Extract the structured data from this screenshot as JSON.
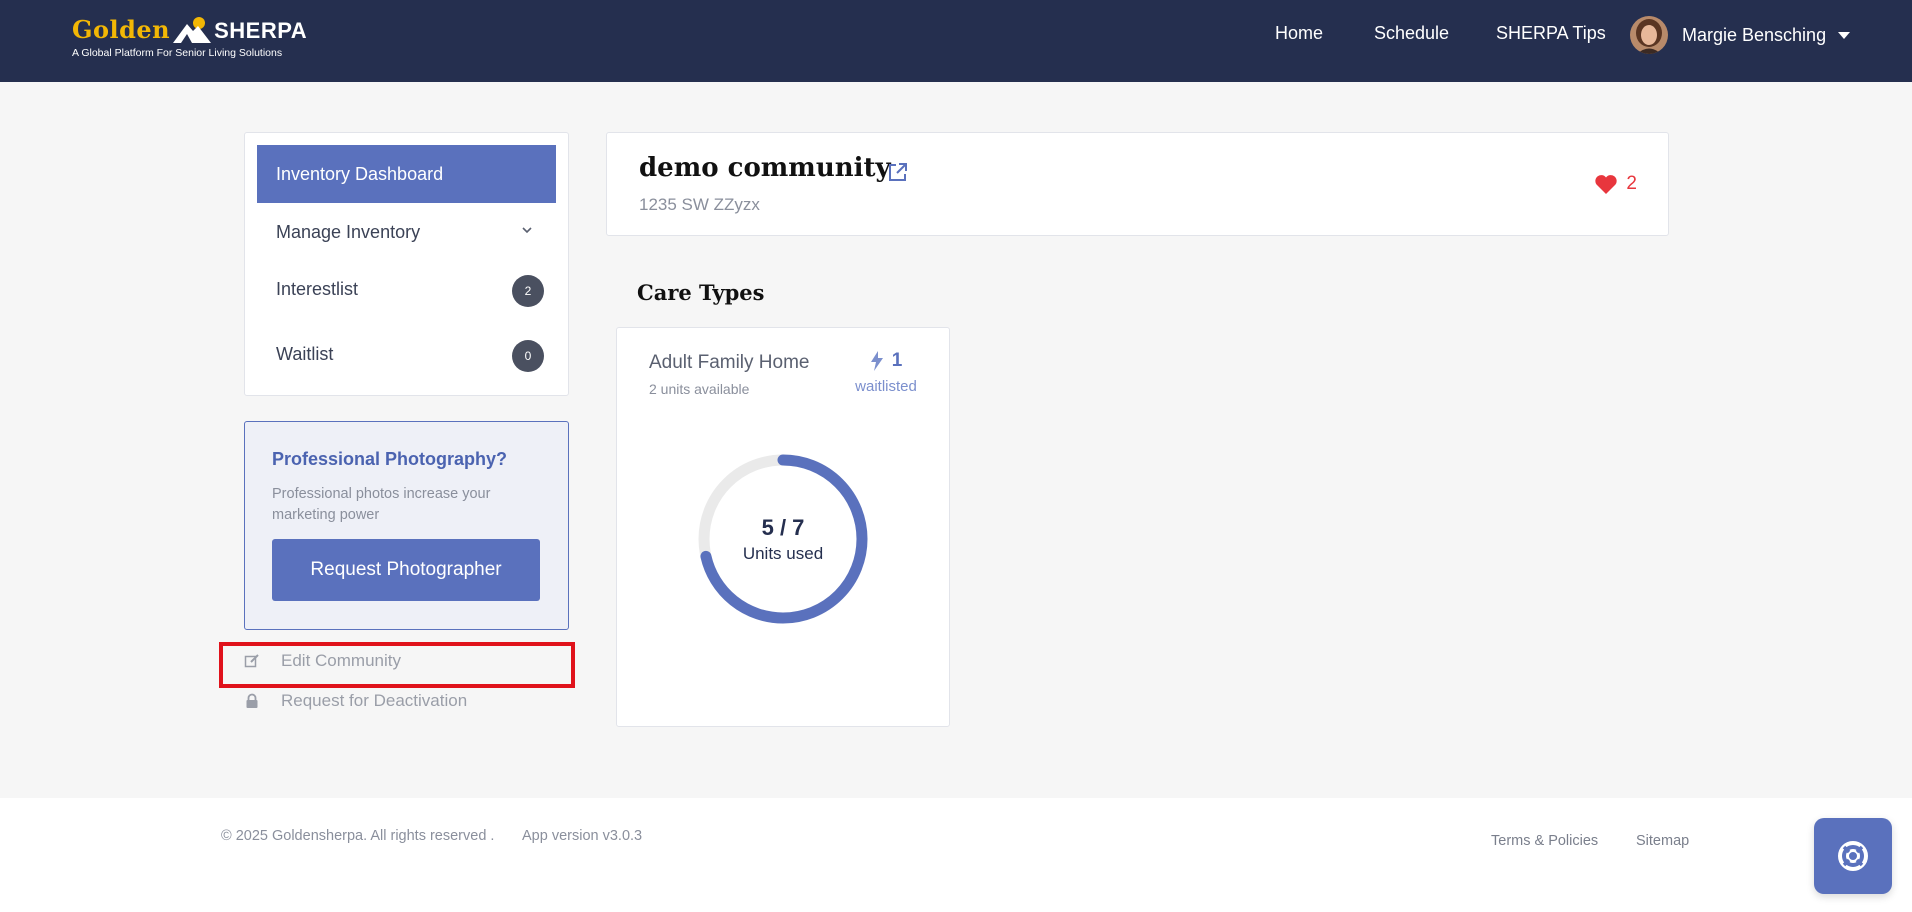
{
  "header": {
    "logo": {
      "golden": "Golden",
      "sherpa": "SHERPA",
      "tagline": "A Global Platform For Senior Living Solutions"
    },
    "nav": [
      {
        "label": "Home"
      },
      {
        "label": "Schedule"
      },
      {
        "label": "SHERPA Tips"
      }
    ],
    "user": {
      "name": "Margie Bensching",
      "avatar_icon": "user-avatar"
    }
  },
  "sidebar": {
    "items": [
      {
        "label": "Inventory Dashboard",
        "active": true
      },
      {
        "label": "Manage Inventory",
        "icon": "chevron-down-icon"
      },
      {
        "label": "Interestlist",
        "badge": "2"
      },
      {
        "label": "Waitlist",
        "badge": "0"
      }
    ],
    "promo": {
      "title": "Professional Photography?",
      "text": "Professional photos increase your marketing power",
      "button_label": "Request Photographer"
    },
    "links": [
      {
        "label": "Edit Community",
        "icon": "edit-icon"
      },
      {
        "label": "Request for Deactivation",
        "icon": "lock-icon"
      }
    ]
  },
  "community": {
    "name": "demo community",
    "address": "1235 SW ZZyzx",
    "favorites": "2",
    "favorite_icon": "heart-icon",
    "link_icon": "external-link-icon"
  },
  "care_types": {
    "title": "Care Types",
    "cards": [
      {
        "name": "Adult Family Home",
        "available": "2 units available",
        "waitlisted_count": "1",
        "waitlisted_label": "waitlisted",
        "units_text": "5 / 7",
        "units_used": 5,
        "units_total": 7,
        "units_label": "Units used"
      }
    ]
  },
  "footer": {
    "copyright": "© 2025 Goldensherpa. All rights reserved .",
    "version": "App version v3.0.3",
    "links": [
      {
        "label": "Terms & Policies"
      },
      {
        "label": "Sitemap"
      }
    ],
    "help_icon": "lifebuoy-icon"
  },
  "colors": {
    "header_bg": "#252f4f",
    "accent": "#5a71bd",
    "brand_gold": "#f2b705",
    "favorite": "#e8363d",
    "highlight": "#e0121b"
  }
}
